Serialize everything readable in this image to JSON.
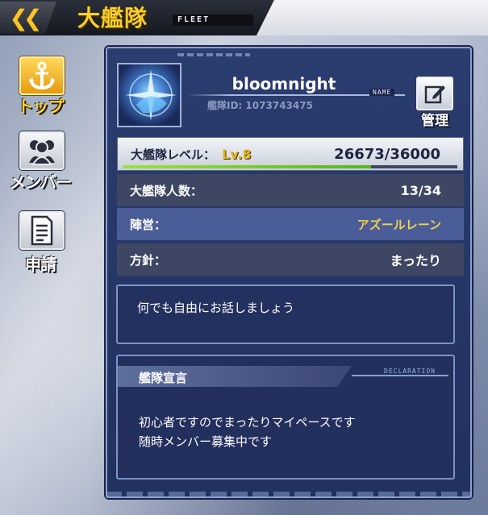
{
  "header": {
    "back_icon": "double-chevron-left-icon",
    "title": "大艦隊",
    "subtitle": "FLEET"
  },
  "nav": {
    "items": [
      {
        "label": "トップ",
        "icon": "anchor-icon",
        "active": true
      },
      {
        "label": "メンバー",
        "icon": "people-icon",
        "active": false
      },
      {
        "label": "申請",
        "icon": "document-icon",
        "active": false
      }
    ]
  },
  "fleet": {
    "name": "bloomnight",
    "name_tag": "NAME",
    "id_label": "艦隊ID: 1073743475",
    "manage_label": "管理",
    "manage_icon": "edit-icon",
    "level_label": "大艦隊レベル：",
    "level_value": "Lv.8",
    "xp_text": "26673/36000",
    "xp_progress": 0.741,
    "members_label": "大艦隊人数：",
    "members_value": "13/34",
    "faction_label": "陣営：",
    "faction_value": "アズールレーン",
    "policy_label": "方針：",
    "policy_value": "まったり",
    "message": "何でも自由にお話しましょう",
    "declaration_title": "艦隊宣言",
    "declaration_tag": "DECLARATION",
    "declaration_line1": "初心者ですのでまったりマイペースです",
    "declaration_line2": "随時メンバー募集中です"
  },
  "colors": {
    "accent_gold": "#f9cf2e",
    "panel_bg": "#2b3c6f",
    "faction_text": "#f0d04a",
    "xp_bar": "#56b81b"
  }
}
